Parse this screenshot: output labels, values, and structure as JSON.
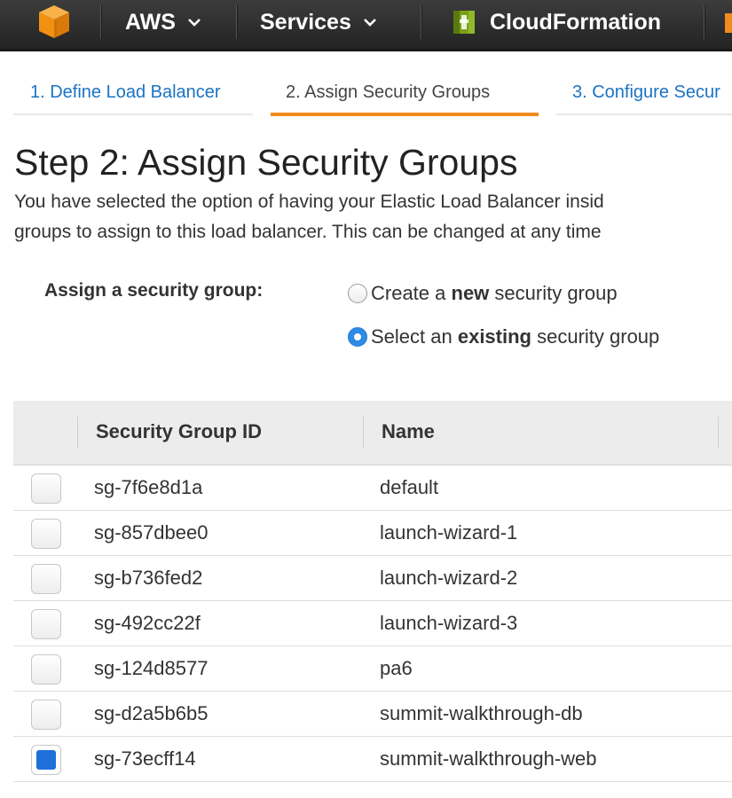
{
  "nav": {
    "account_label": "AWS",
    "services_label": "Services",
    "service_name": "CloudFormation"
  },
  "wizard": {
    "tabs": [
      {
        "label": "1. Define Load Balancer",
        "state": "inactive"
      },
      {
        "label": "2. Assign Security Groups",
        "state": "active"
      },
      {
        "label": "3. Configure Secur",
        "state": "inactive"
      }
    ]
  },
  "page": {
    "title": "Step 2: Assign Security Groups",
    "description_line1": "You have selected the option of having your Elastic Load Balancer insid",
    "description_line2": "groups to assign to this load balancer. This can be changed at any time"
  },
  "assign": {
    "label": "Assign a security group:",
    "options": [
      {
        "prefix": "Create a ",
        "emphasis": "new",
        "suffix": " security group",
        "selected": false
      },
      {
        "prefix": "Select an ",
        "emphasis": "existing",
        "suffix": " security group",
        "selected": true
      }
    ]
  },
  "table": {
    "columns": [
      "Security Group ID",
      "Name"
    ],
    "rows": [
      {
        "id": "sg-7f6e8d1a",
        "name": "default",
        "checked": false
      },
      {
        "id": "sg-857dbee0",
        "name": "launch-wizard-1",
        "checked": false
      },
      {
        "id": "sg-b736fed2",
        "name": "launch-wizard-2",
        "checked": false
      },
      {
        "id": "sg-492cc22f",
        "name": "launch-wizard-3",
        "checked": false
      },
      {
        "id": "sg-124d8577",
        "name": "pa6",
        "checked": false
      },
      {
        "id": "sg-d2a5b6b5",
        "name": "summit-walkthrough-db",
        "checked": false
      },
      {
        "id": "sg-73ecff14",
        "name": "summit-walkthrough-web",
        "checked": true
      }
    ]
  },
  "colors": {
    "nav_bg": "#2b2b2b",
    "accent_orange": "#f28a1d",
    "link_blue": "#1a73c4",
    "checked_blue": "#1f6fdb",
    "table_header_bg": "#ececec"
  },
  "icons": {
    "logo": "aws-cube-icon",
    "dropdown": "chevron-down-icon",
    "service": "cloudformation-icon"
  }
}
